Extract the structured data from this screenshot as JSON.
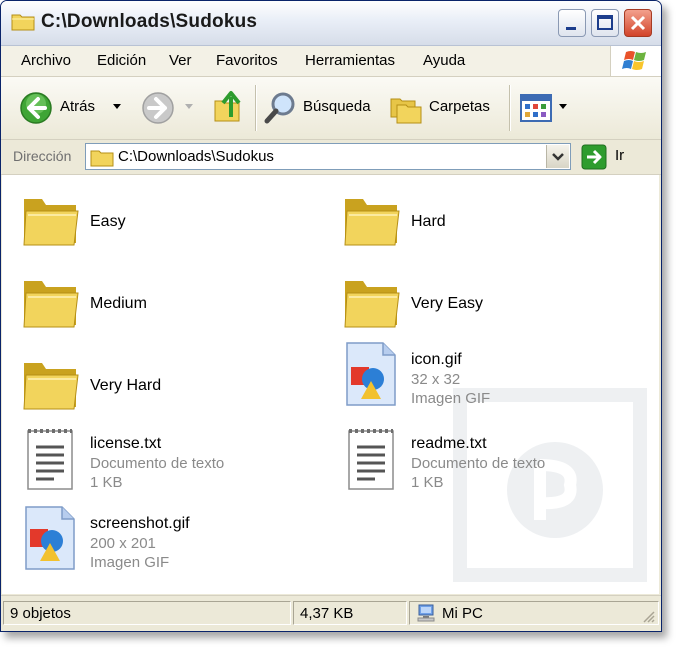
{
  "window": {
    "title": "C:\\Downloads\\Sudokus"
  },
  "menu": [
    "Archivo",
    "Edición",
    "Ver",
    "Favoritos",
    "Herramientas",
    "Ayuda"
  ],
  "toolbar": {
    "back_label": "Atrás",
    "search_label": "Búsqueda",
    "folders_label": "Carpetas"
  },
  "address": {
    "label": "Dirección",
    "value": "C:\\Downloads\\Sudokus",
    "go_label": "Ir"
  },
  "items": [
    {
      "name": "Easy",
      "type": "folder"
    },
    {
      "name": "Hard",
      "type": "folder"
    },
    {
      "name": "Medium",
      "type": "folder"
    },
    {
      "name": "Very Easy",
      "type": "folder"
    },
    {
      "name": "Very Hard",
      "type": "folder"
    },
    {
      "name": "icon.gif",
      "type": "image",
      "detail1": "32 x 32",
      "detail2": "Imagen GIF"
    },
    {
      "name": "license.txt",
      "type": "text",
      "detail1": "Documento de texto",
      "detail2": "1 KB"
    },
    {
      "name": "readme.txt",
      "type": "text",
      "detail1": "Documento de texto",
      "detail2": "1 KB"
    },
    {
      "name": "screenshot.gif",
      "type": "image",
      "detail1": "200 x 201",
      "detail2": "Imagen GIF"
    }
  ],
  "status": {
    "count": "9 objetos",
    "size": "4,37 KB",
    "location": "Mi PC"
  },
  "colors": {
    "folder": "#f2d45c",
    "folder_dark": "#c9a21f",
    "back_arrow": "#3fa535",
    "go_arrow": "#2e9c2e",
    "close_button": "#d2442a"
  }
}
